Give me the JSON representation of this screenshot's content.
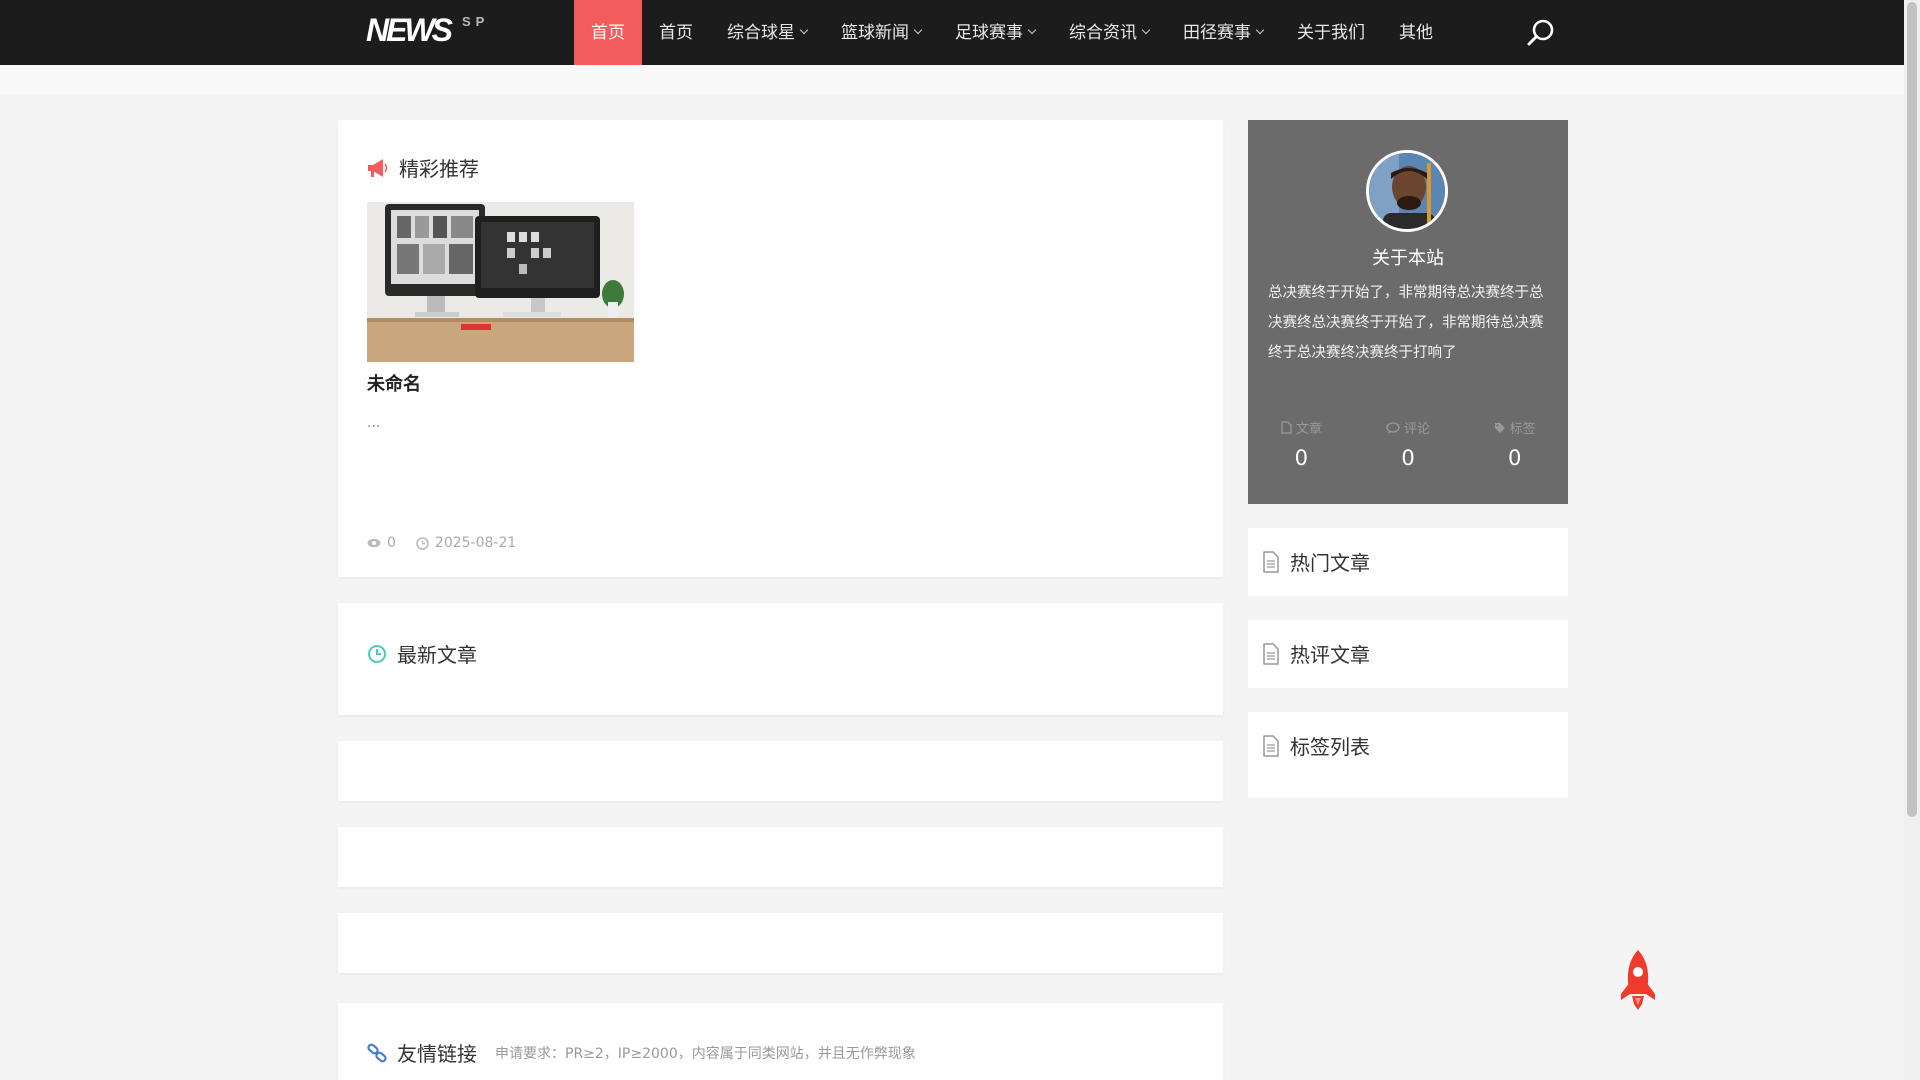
{
  "brand": {
    "logo_main": "NEWS",
    "logo_sub": "SP"
  },
  "nav": {
    "items": [
      {
        "label": "首页",
        "active": true,
        "dropdown": false
      },
      {
        "label": "首页",
        "active": false,
        "dropdown": false
      },
      {
        "label": "综合球星",
        "active": false,
        "dropdown": true
      },
      {
        "label": "篮球新闻",
        "active": false,
        "dropdown": true
      },
      {
        "label": "足球赛事",
        "active": false,
        "dropdown": true
      },
      {
        "label": "综合资讯",
        "active": false,
        "dropdown": true
      },
      {
        "label": "田径赛事",
        "active": false,
        "dropdown": true
      },
      {
        "label": "关于我们",
        "active": false,
        "dropdown": false
      },
      {
        "label": "其他",
        "active": false,
        "dropdown": false
      }
    ]
  },
  "featured": {
    "title": "精彩推荐",
    "article": {
      "title": "未命名",
      "excerpt": "...",
      "views": "0",
      "date": "2025-08-21"
    }
  },
  "latest": {
    "title": "最新文章"
  },
  "links": {
    "title": "友情链接",
    "note": "申请要求：PR≥2，IP≥2000，内容属于同类网站，并且无作弊现象"
  },
  "about": {
    "title": "关于本站",
    "desc": "总决赛终于开始了，非常期待总决赛终于总决赛终总决赛终于开始了，非常期待总决赛终于总决赛终决赛终于打响了",
    "stats": [
      {
        "label": "文章",
        "value": "0",
        "icon": "file-icon"
      },
      {
        "label": "评论",
        "value": "0",
        "icon": "comment-icon"
      },
      {
        "label": "标签",
        "value": "0",
        "icon": "tag-icon"
      }
    ]
  },
  "sidebar": {
    "hot": "热门文章",
    "hot_comments": "热评文章",
    "tags": "标签列表"
  },
  "colors": {
    "accent": "#f25c5c",
    "topbar": "#1c1c1c",
    "about_bg": "#6b6b6b",
    "clock": "#4cc9c0",
    "link_icon": "#4a7bd0"
  }
}
